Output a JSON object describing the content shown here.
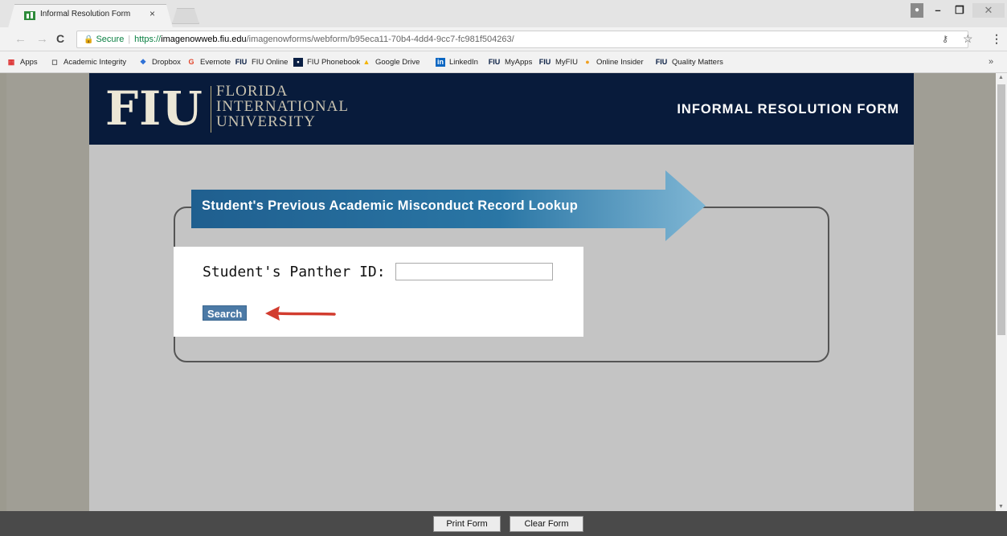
{
  "browser": {
    "tab_title": "Informal Resolution Form",
    "tab_close": "×",
    "secure_label": "Secure",
    "url_scheme": "https://",
    "url_host": "imagenowweb.fiu.edu",
    "url_path": "/imagenowforms/webform/b95eca11-70b4-4dd4-9cc7-fc981f504263/",
    "bookmarks": [
      {
        "label": "Apps",
        "icon": "apps-grid-icon"
      },
      {
        "label": "Academic Integrity",
        "icon": "page-icon"
      },
      {
        "label": "Dropbox",
        "icon": "dropbox-icon"
      },
      {
        "label": "Evernote",
        "icon": "google-icon"
      },
      {
        "label": "FIU Online",
        "icon": "fiu-icon"
      },
      {
        "label": "FIU Phonebook",
        "icon": "fiu-phonebook-icon"
      },
      {
        "label": "Google Drive",
        "icon": "google-drive-icon"
      },
      {
        "label": "LinkedIn",
        "icon": "linkedin-icon"
      },
      {
        "label": "MyApps",
        "icon": "fiu-icon"
      },
      {
        "label": "MyFIU",
        "icon": "fiu-icon"
      },
      {
        "label": "Online Insider",
        "icon": "online-insider-icon"
      },
      {
        "label": "Quality Matters",
        "icon": "fiu-icon"
      }
    ],
    "bookmarks_more": "»"
  },
  "header": {
    "logo_text": "FIU",
    "university_line1": "FLORIDA",
    "university_line2": "INTERNATIONAL",
    "university_line3": "UNIVERSITY",
    "form_title": "INFORMAL RESOLUTION FORM"
  },
  "lookup": {
    "banner_title": "Student's Previous Academic Misconduct Record Lookup",
    "panther_id_label": "Student's Panther ID:",
    "panther_id_value": "",
    "search_label": "Search"
  },
  "footer": {
    "print_label": "Print Form",
    "clear_label": "Clear Form"
  },
  "colors": {
    "header_bg": "#081b3b",
    "banner_blue": "#1e5e8c",
    "search_button": "#4c7aa6",
    "arrow_red": "#d23c2f"
  }
}
